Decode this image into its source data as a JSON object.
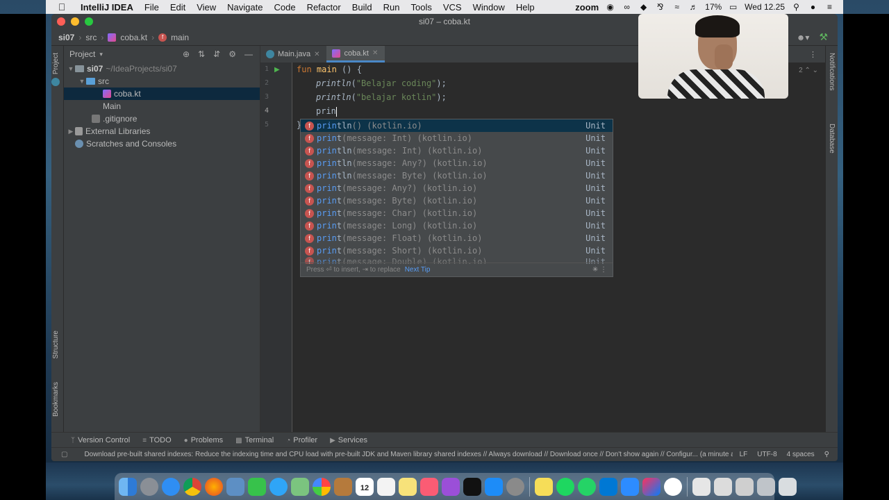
{
  "menubar": {
    "app": "IntelliJ IDEA",
    "items": [
      "File",
      "Edit",
      "View",
      "Navigate",
      "Code",
      "Refactor",
      "Build",
      "Run",
      "Tools",
      "VCS",
      "Window",
      "Help"
    ],
    "zoom": "zoom",
    "battery": "17%",
    "clock": "Wed 12.25"
  },
  "window": {
    "title": "si07 – coba.kt"
  },
  "navbar": {
    "project": "si07",
    "folder": "src",
    "file": "coba.kt",
    "function": "main"
  },
  "project_panel": {
    "title": "Project",
    "rows": [
      {
        "name": "si07",
        "path": "~/IdeaProjects/si07"
      },
      {
        "name": "src"
      },
      {
        "name": "coba.kt"
      },
      {
        "name": "Main"
      },
      {
        "name": ".gitignore"
      },
      {
        "name": "External Libraries"
      },
      {
        "name": "Scratches and Consoles"
      }
    ]
  },
  "left_strip": {
    "project": "Project",
    "structure": "Structure",
    "bookmarks": "Bookmarks"
  },
  "right_strip": {
    "notifications": "Notifications",
    "database": "Database"
  },
  "tabs": [
    {
      "label": "Main.java"
    },
    {
      "label": "coba.kt"
    }
  ],
  "editor": {
    "line_numbers": [
      "1",
      "2",
      "3",
      "4",
      "5"
    ],
    "warning_count": "2",
    "line1": {
      "kw": "fun",
      "name": "main",
      "rest": " () {"
    },
    "line2": {
      "fn": "println",
      "open": "(",
      "str": "\"Belajar coding\"",
      "close": ");"
    },
    "line3": {
      "fn": "println",
      "open": "(",
      "str": "\"belajar kotlin\"",
      "close": ");"
    },
    "line4": "prin",
    "line5": "}"
  },
  "completion": {
    "rows": [
      {
        "match": "prin",
        "rest": "tln",
        "sig": "() (kotlin.io)",
        "type": "Unit"
      },
      {
        "match": "prin",
        "rest": "t",
        "sig": "(message: Int) (kotlin.io)",
        "type": "Unit"
      },
      {
        "match": "prin",
        "rest": "tln",
        "sig": "(message: Int) (kotlin.io)",
        "type": "Unit"
      },
      {
        "match": "prin",
        "rest": "tln",
        "sig": "(message: Any?) (kotlin.io)",
        "type": "Unit"
      },
      {
        "match": "prin",
        "rest": "tln",
        "sig": "(message: Byte) (kotlin.io)",
        "type": "Unit"
      },
      {
        "match": "prin",
        "rest": "t",
        "sig": "(message: Any?) (kotlin.io)",
        "type": "Unit"
      },
      {
        "match": "prin",
        "rest": "t",
        "sig": "(message: Byte) (kotlin.io)",
        "type": "Unit"
      },
      {
        "match": "prin",
        "rest": "t",
        "sig": "(message: Char) (kotlin.io)",
        "type": "Unit"
      },
      {
        "match": "prin",
        "rest": "t",
        "sig": "(message: Long) (kotlin.io)",
        "type": "Unit"
      },
      {
        "match": "prin",
        "rest": "t",
        "sig": "(message: Float) (kotlin.io)",
        "type": "Unit"
      },
      {
        "match": "prin",
        "rest": "t",
        "sig": "(message: Short) (kotlin.io)",
        "type": "Unit"
      },
      {
        "match": "prin",
        "rest": "t",
        "sig": "(message: Double) (kotlin.io)",
        "type": "Unit"
      }
    ],
    "footer_hint": "Press ⏎ to insert, ⇥ to replace",
    "next_tip": "Next Tip"
  },
  "tool_windows": [
    "Version Control",
    "TODO",
    "Problems",
    "Terminal",
    "Profiler",
    "Services"
  ],
  "status": {
    "message": "Download pre-built shared indexes: Reduce the indexing time and CPU load with pre-built JDK and Maven library shared indexes // Always download // Download once // Don't show again // Configur... (a minute ago)",
    "line_sep": "LF",
    "encoding": "UTF-8",
    "indent": "4 spaces"
  },
  "dock": {
    "calendar_day": "12"
  },
  "colors": {
    "accent": "#4a88c7",
    "keyword": "#cc7832",
    "string": "#6a8759",
    "function_badge": "#c75450",
    "match": "#589df6"
  }
}
